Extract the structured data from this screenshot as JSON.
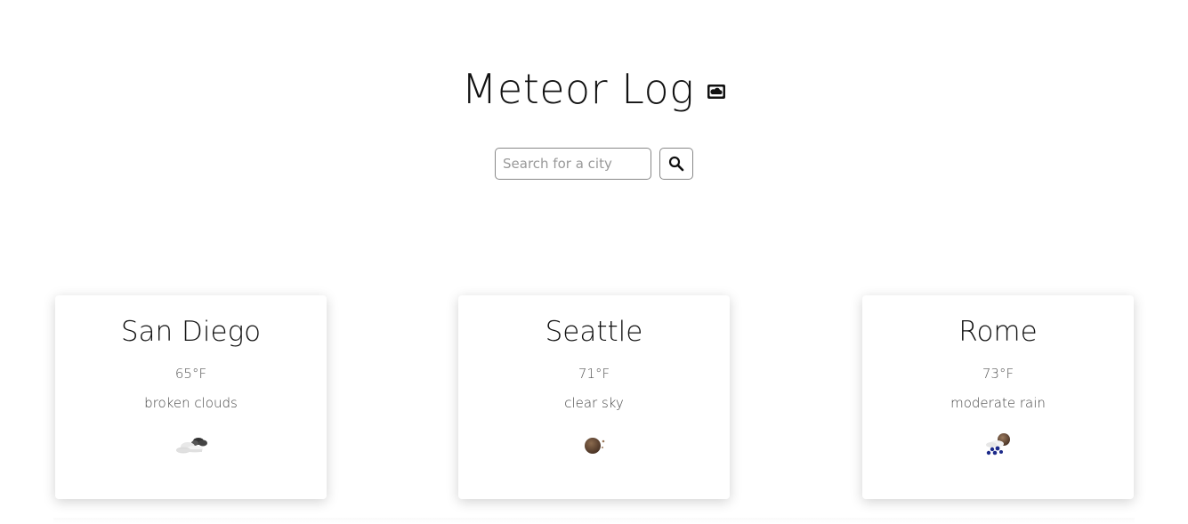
{
  "header": {
    "title": "Meteor Log",
    "title_icon": "cloud-icon"
  },
  "search": {
    "placeholder": "Search for a city",
    "value": "",
    "button_icon": "search-icon"
  },
  "cards": [
    {
      "city": "San Diego",
      "temp": "65°F",
      "description": "broken clouds",
      "icon": "broken-clouds-icon"
    },
    {
      "city": "Seattle",
      "temp": "71°F",
      "description": "clear sky",
      "icon": "clear-sky-icon"
    },
    {
      "city": "Rome",
      "temp": "73°F",
      "description": "moderate rain",
      "icon": "moderate-rain-icon"
    }
  ]
}
